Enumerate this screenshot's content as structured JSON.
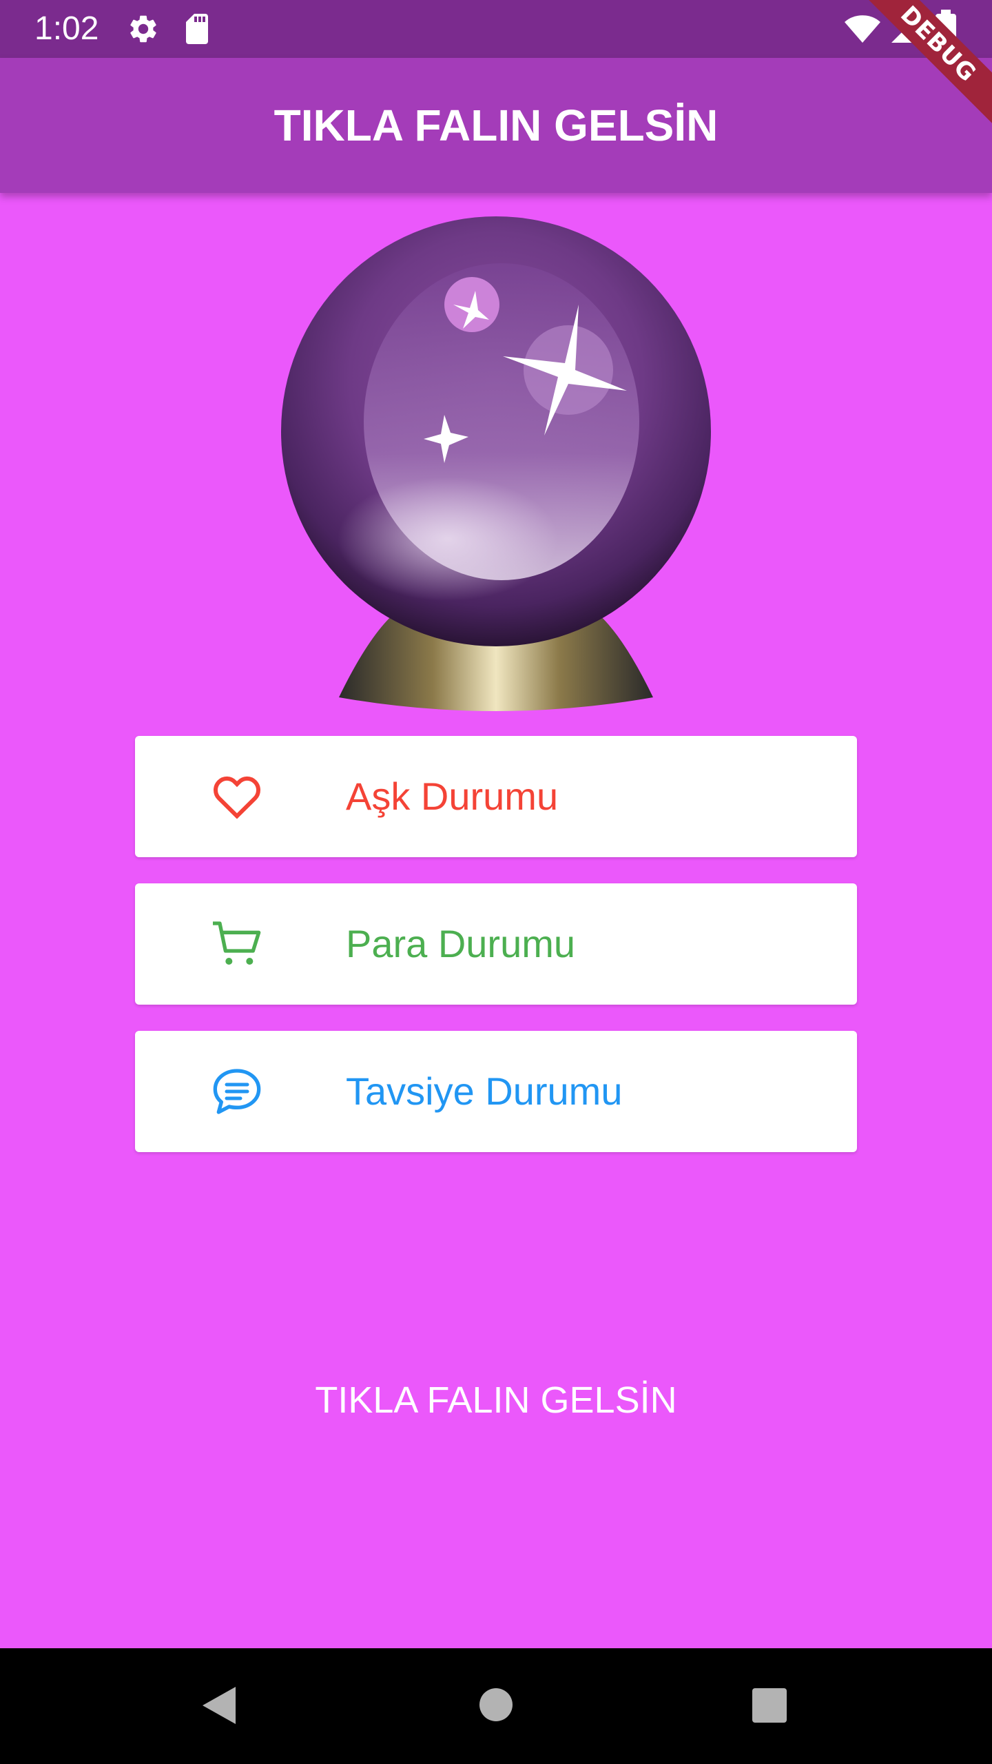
{
  "status_bar": {
    "time": "1:02",
    "icons": [
      "settings-icon",
      "sd-card-icon",
      "wifi-icon",
      "signal-icon",
      "battery-icon"
    ]
  },
  "app_bar": {
    "title": "TIKLA FALIN GELSİN",
    "color": "#A43CB9"
  },
  "debug_banner": "DEBUG",
  "hero_image": "crystal-ball",
  "buttons": [
    {
      "label": "Aşk Durumu",
      "icon": "heart-icon",
      "color": "#F44336"
    },
    {
      "label": "Para Durumu",
      "icon": "cart-icon",
      "color": "#4CAF50"
    },
    {
      "label": "Tavsiye Durumu",
      "icon": "chat-icon",
      "color": "#2196F3"
    }
  ],
  "footer": {
    "text": "TIKLA FALIN GELSİN"
  },
  "nav_bar": {
    "icons": [
      "back-icon",
      "home-icon",
      "recents-icon"
    ]
  },
  "colors": {
    "background": "#EB58FB",
    "status_bar": "#7B2B8E"
  }
}
